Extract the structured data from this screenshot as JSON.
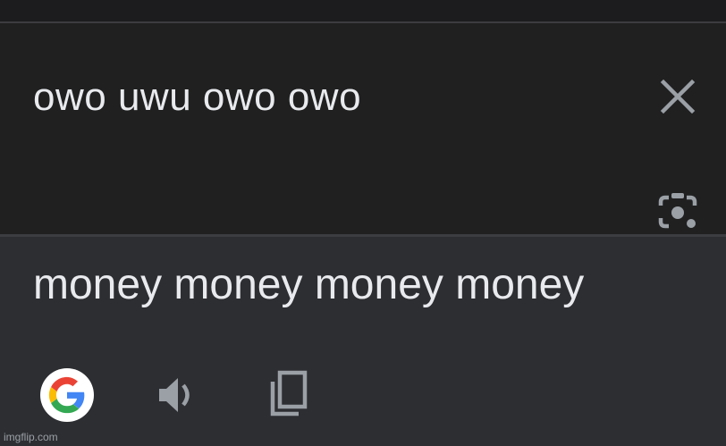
{
  "source": {
    "text": "owo uwu owo owo",
    "close_icon": "close-icon",
    "lens_icon": "camera-lens-icon"
  },
  "translation": {
    "text": "money money money money",
    "google_icon": "google-g-icon",
    "speaker_icon": "volume-icon",
    "copy_icon": "copy-icon"
  },
  "watermark": "imgflip.com",
  "colors": {
    "text": "#e8eaed",
    "icon": "#9aa0a6",
    "input_bg": "#202021",
    "output_bg": "#2d2e32"
  }
}
